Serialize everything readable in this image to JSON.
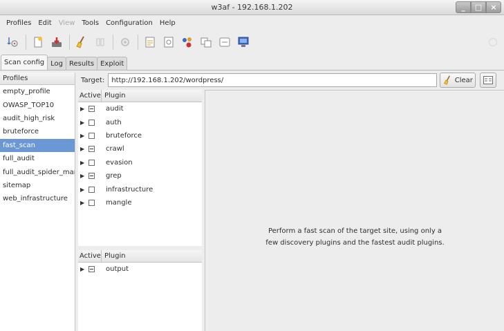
{
  "window": {
    "title": "w3af - 192.168.1.202"
  },
  "menu": [
    {
      "label": "Profiles",
      "enabled": true
    },
    {
      "label": "Edit",
      "enabled": true
    },
    {
      "label": "View",
      "enabled": false
    },
    {
      "label": "Tools",
      "enabled": true
    },
    {
      "label": "Configuration",
      "enabled": true
    },
    {
      "label": "Help",
      "enabled": true
    }
  ],
  "toolbar": {
    "icons": [
      "target-wizard-icon",
      "new-profile-icon",
      "save-profile-icon",
      "clear-scan-icon",
      "pause-icon",
      "exploit-icon",
      "manual-request-icon",
      "fuzzy-request-icon",
      "encode-decode-icon",
      "export-request-icon",
      "compare-icon",
      "proxy-icon"
    ]
  },
  "tabs": [
    {
      "label": "Scan config",
      "active": true
    },
    {
      "label": "Log",
      "active": false
    },
    {
      "label": "Results",
      "active": false
    },
    {
      "label": "Exploit",
      "active": false
    }
  ],
  "profiles": {
    "header": "Profiles",
    "items": [
      "empty_profile",
      "OWASP_TOP10",
      "audit_high_risk",
      "bruteforce",
      "fast_scan",
      "full_audit",
      "full_audit_spider_man",
      "sitemap",
      "web_infrastructure"
    ],
    "selected": "fast_scan"
  },
  "target": {
    "label": "Target:",
    "value": "http://192.168.1.202/wordpress/",
    "clear_label": "Clear"
  },
  "plugins": {
    "header_active": "Active",
    "header_plugin": "Plugin",
    "items": [
      {
        "name": "audit",
        "state": "mixed"
      },
      {
        "name": "auth",
        "state": "off"
      },
      {
        "name": "bruteforce",
        "state": "off"
      },
      {
        "name": "crawl",
        "state": "mixed"
      },
      {
        "name": "evasion",
        "state": "off"
      },
      {
        "name": "grep",
        "state": "mixed"
      },
      {
        "name": "infrastructure",
        "state": "off"
      },
      {
        "name": "mangle",
        "state": "off"
      }
    ]
  },
  "output_plugins": {
    "header_active": "Active",
    "header_plugin": "Plugin",
    "items": [
      {
        "name": "output",
        "state": "mixed"
      }
    ]
  },
  "description": {
    "line1": "Perform a fast scan of the target site, using only a",
    "line2": "few discovery plugins and the fastest audit plugins."
  }
}
